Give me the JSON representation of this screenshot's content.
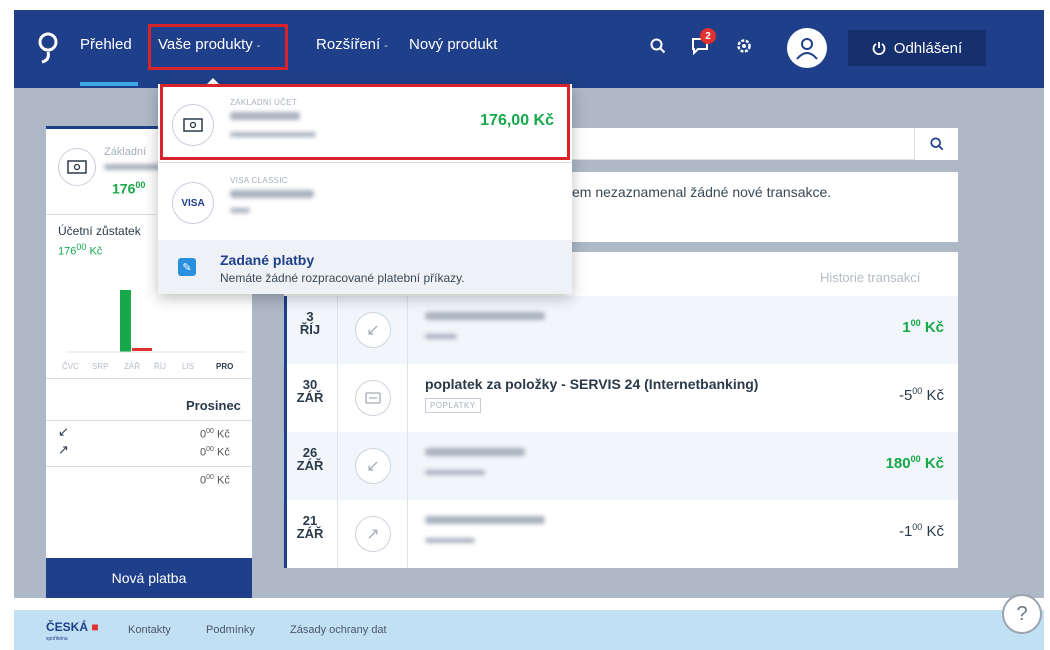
{
  "nav": {
    "items": [
      {
        "label": "Přehled"
      },
      {
        "label": "Vaše produkty",
        "caret": "-"
      },
      {
        "label": "Rozšíření",
        "caret": "-"
      },
      {
        "label": "Nový produkt"
      }
    ],
    "notifications_count": "2",
    "logout_label": "Odhlášení"
  },
  "dropdown": {
    "items": [
      {
        "product_type": "ZÁKLADNÍ ÚČET",
        "amount": "176,00 Kč",
        "icon": "banknote-icon"
      },
      {
        "product_type": "VISA CLASSIC",
        "icon_text": "VISA",
        "icon": "visa-card-icon"
      }
    ],
    "footer": {
      "title": "Zadané platby",
      "subtitle": "Nemáte žádné rozpracované platební příkazy."
    }
  },
  "left_card": {
    "account_label": "Základní",
    "balance_main": "176",
    "balance_decimals": "00",
    "accounting_balance_label": "Účetní zůstatek",
    "accounting_balance_main": "176",
    "accounting_balance_decimals": "00",
    "currency": "Kč",
    "chart_months": [
      "ČVC",
      "SRP",
      "ZÁŘ",
      "ŘÍJ",
      "LIS",
      "PRO"
    ],
    "period_label": "Prosinec",
    "incoming": "0",
    "outgoing": "0",
    "total": "0",
    "decimals": "00",
    "new_payment_label": "Nová platba"
  },
  "info": {
    "text": "em nezaznamenal žádné nové transakce."
  },
  "transactions": {
    "header_link": "Historie transakcí",
    "rows": [
      {
        "day": "3",
        "month": "ŘÍJ",
        "title": "",
        "tag": "",
        "amount_main": "1",
        "amount_dec": "00",
        "currency": "Kč",
        "direction": "in"
      },
      {
        "day": "30",
        "month": "ZÁŘ",
        "title": "poplatek za položky - SERVIS 24 (Internetbanking)",
        "tag": "POPLATKY",
        "amount_main": "-5",
        "amount_dec": "00",
        "currency": "Kč",
        "direction": "fee"
      },
      {
        "day": "26",
        "month": "ZÁŘ",
        "title": "",
        "tag": "",
        "amount_main": "180",
        "amount_dec": "00",
        "currency": "Kč",
        "direction": "in"
      },
      {
        "day": "21",
        "month": "ZÁŘ",
        "title": "",
        "tag": "",
        "amount_main": "-1",
        "amount_dec": "00",
        "currency": "Kč",
        "direction": "out"
      }
    ]
  },
  "footer": {
    "logo": "ČESKÁ",
    "logo_sub": "spořitelna",
    "links": [
      "Kontakty",
      "Podmínky",
      "Zásady ochrany dat"
    ]
  },
  "colors": {
    "nav_bg": "#1f3f8a",
    "accent_green": "#17a84a",
    "highlight_red": "#d8232a"
  }
}
